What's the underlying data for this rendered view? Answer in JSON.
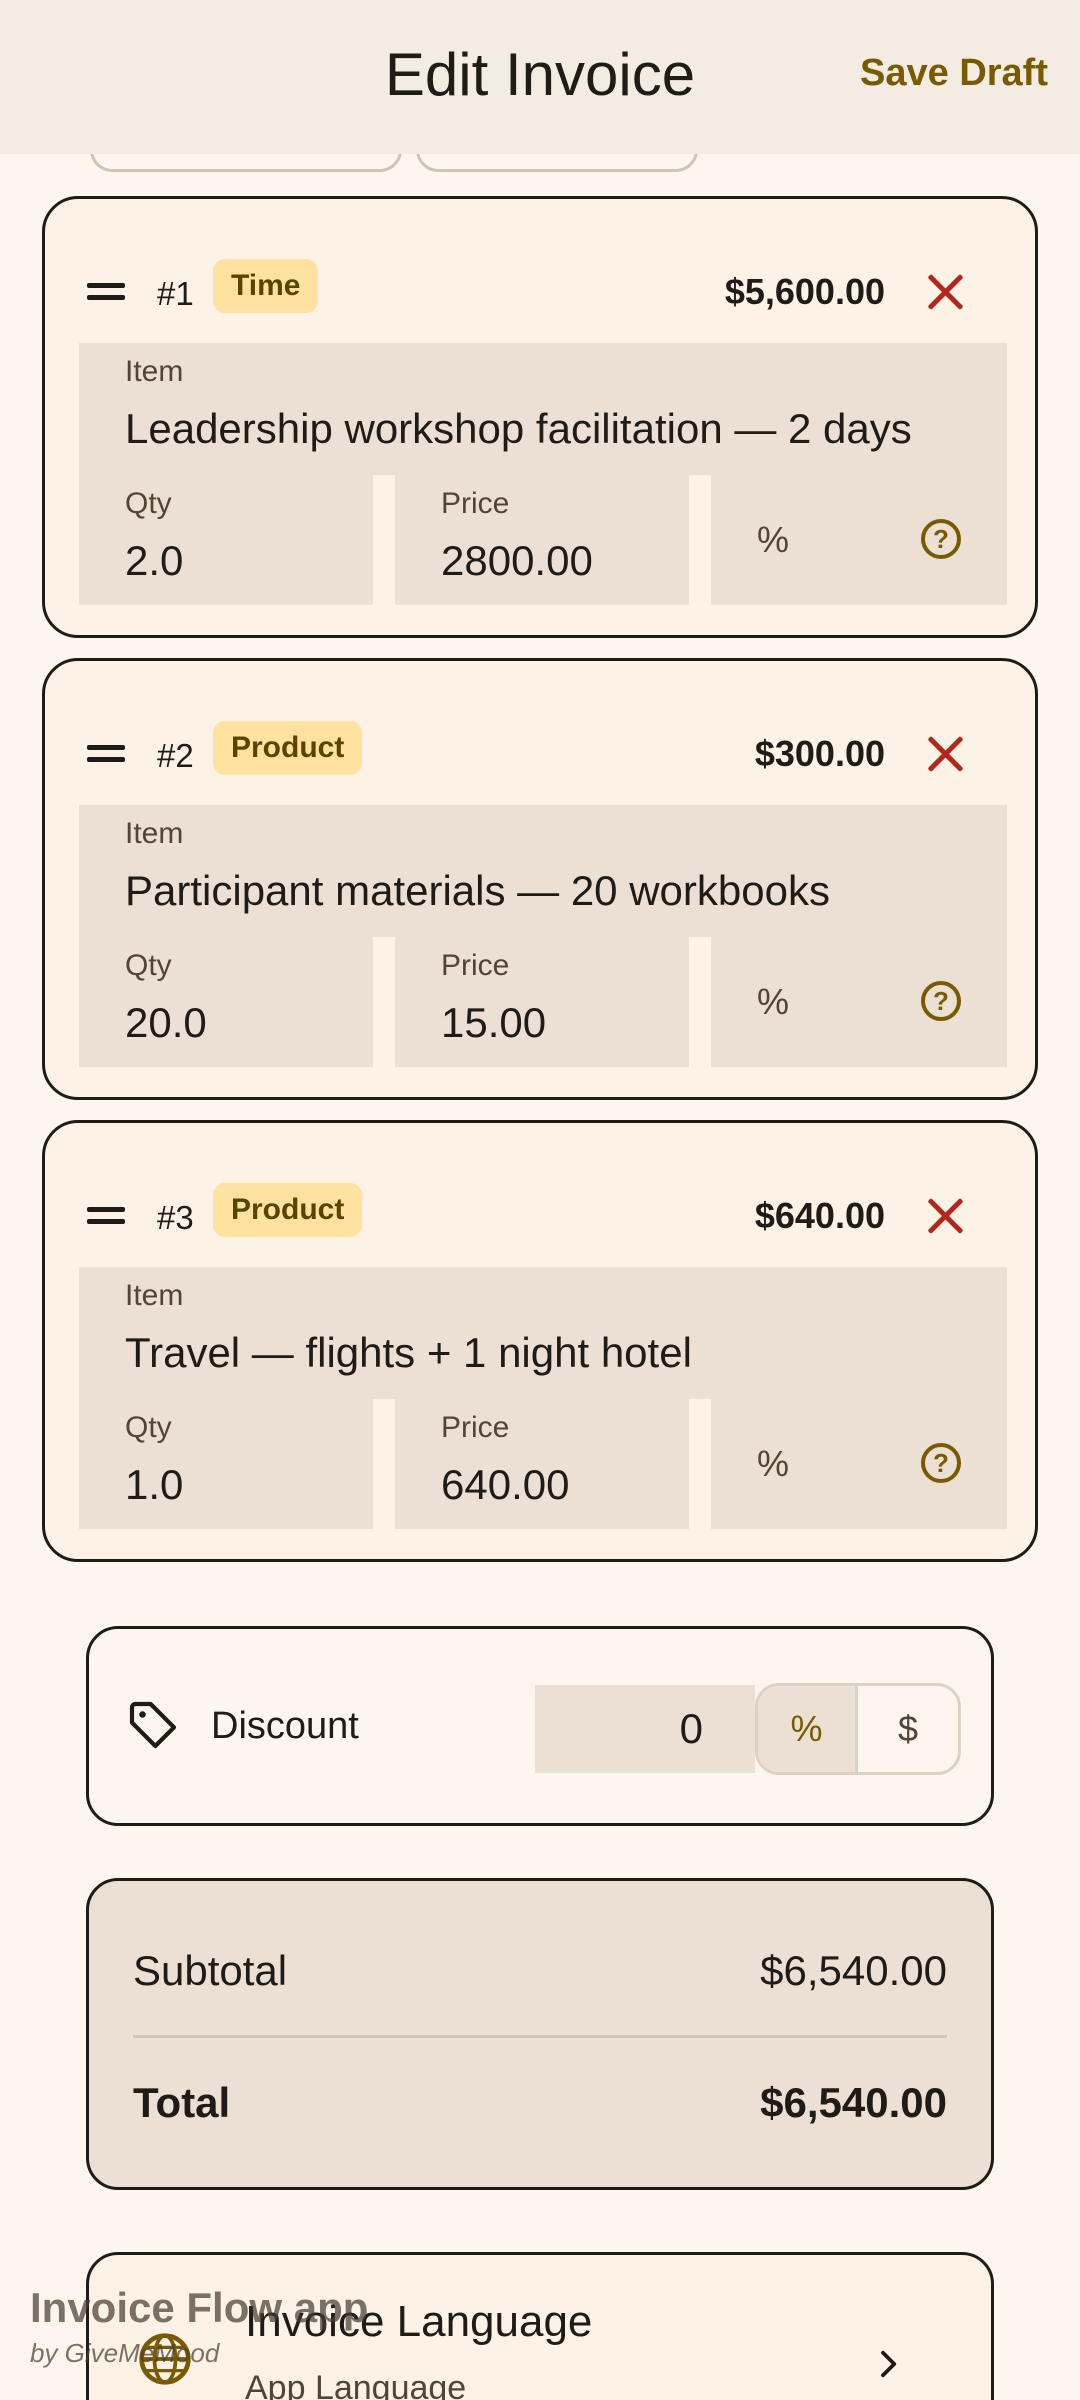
{
  "header": {
    "title": "Edit Invoice",
    "save_draft_label": "Save Draft"
  },
  "line_items": [
    {
      "number": "#1",
      "type": "Time",
      "amount": "$5,600.00",
      "item_label": "Item",
      "item_value": "Leadership workshop facilitation — 2 days",
      "qty_label": "Qty",
      "qty_value": "2.0",
      "price_label": "Price",
      "price_value": "2800.00",
      "percent_symbol": "%"
    },
    {
      "number": "#2",
      "type": "Product",
      "amount": "$300.00",
      "item_label": "Item",
      "item_value": "Participant materials — 20 workbooks",
      "qty_label": "Qty",
      "qty_value": "20.0",
      "price_label": "Price",
      "price_value": "15.00",
      "percent_symbol": "%"
    },
    {
      "number": "#3",
      "type": "Product",
      "amount": "$640.00",
      "item_label": "Item",
      "item_value": "Travel — flights + 1 night hotel",
      "qty_label": "Qty",
      "qty_value": "1.0",
      "price_label": "Price",
      "price_value": "640.00",
      "percent_symbol": "%"
    }
  ],
  "discount": {
    "label": "Discount",
    "value": "0",
    "options": [
      "%",
      "$"
    ],
    "selected": "%"
  },
  "totals": {
    "subtotal_label": "Subtotal",
    "subtotal_value": "$6,540.00",
    "total_label": "Total",
    "total_value": "$6,540.00"
  },
  "language": {
    "title": "Invoice Language",
    "subtitle": "App Language"
  },
  "watermark": {
    "title": "Invoice Flow app",
    "subtitle": "by GiveMeMood"
  },
  "colors": {
    "accent": "#7a5a00",
    "badge_bg": "#ffe29f",
    "remove": "#b3261e",
    "field_bg": "#ebe0d3",
    "card_bg": "#fdf2e6",
    "page_bg": "#fdf6ef"
  }
}
